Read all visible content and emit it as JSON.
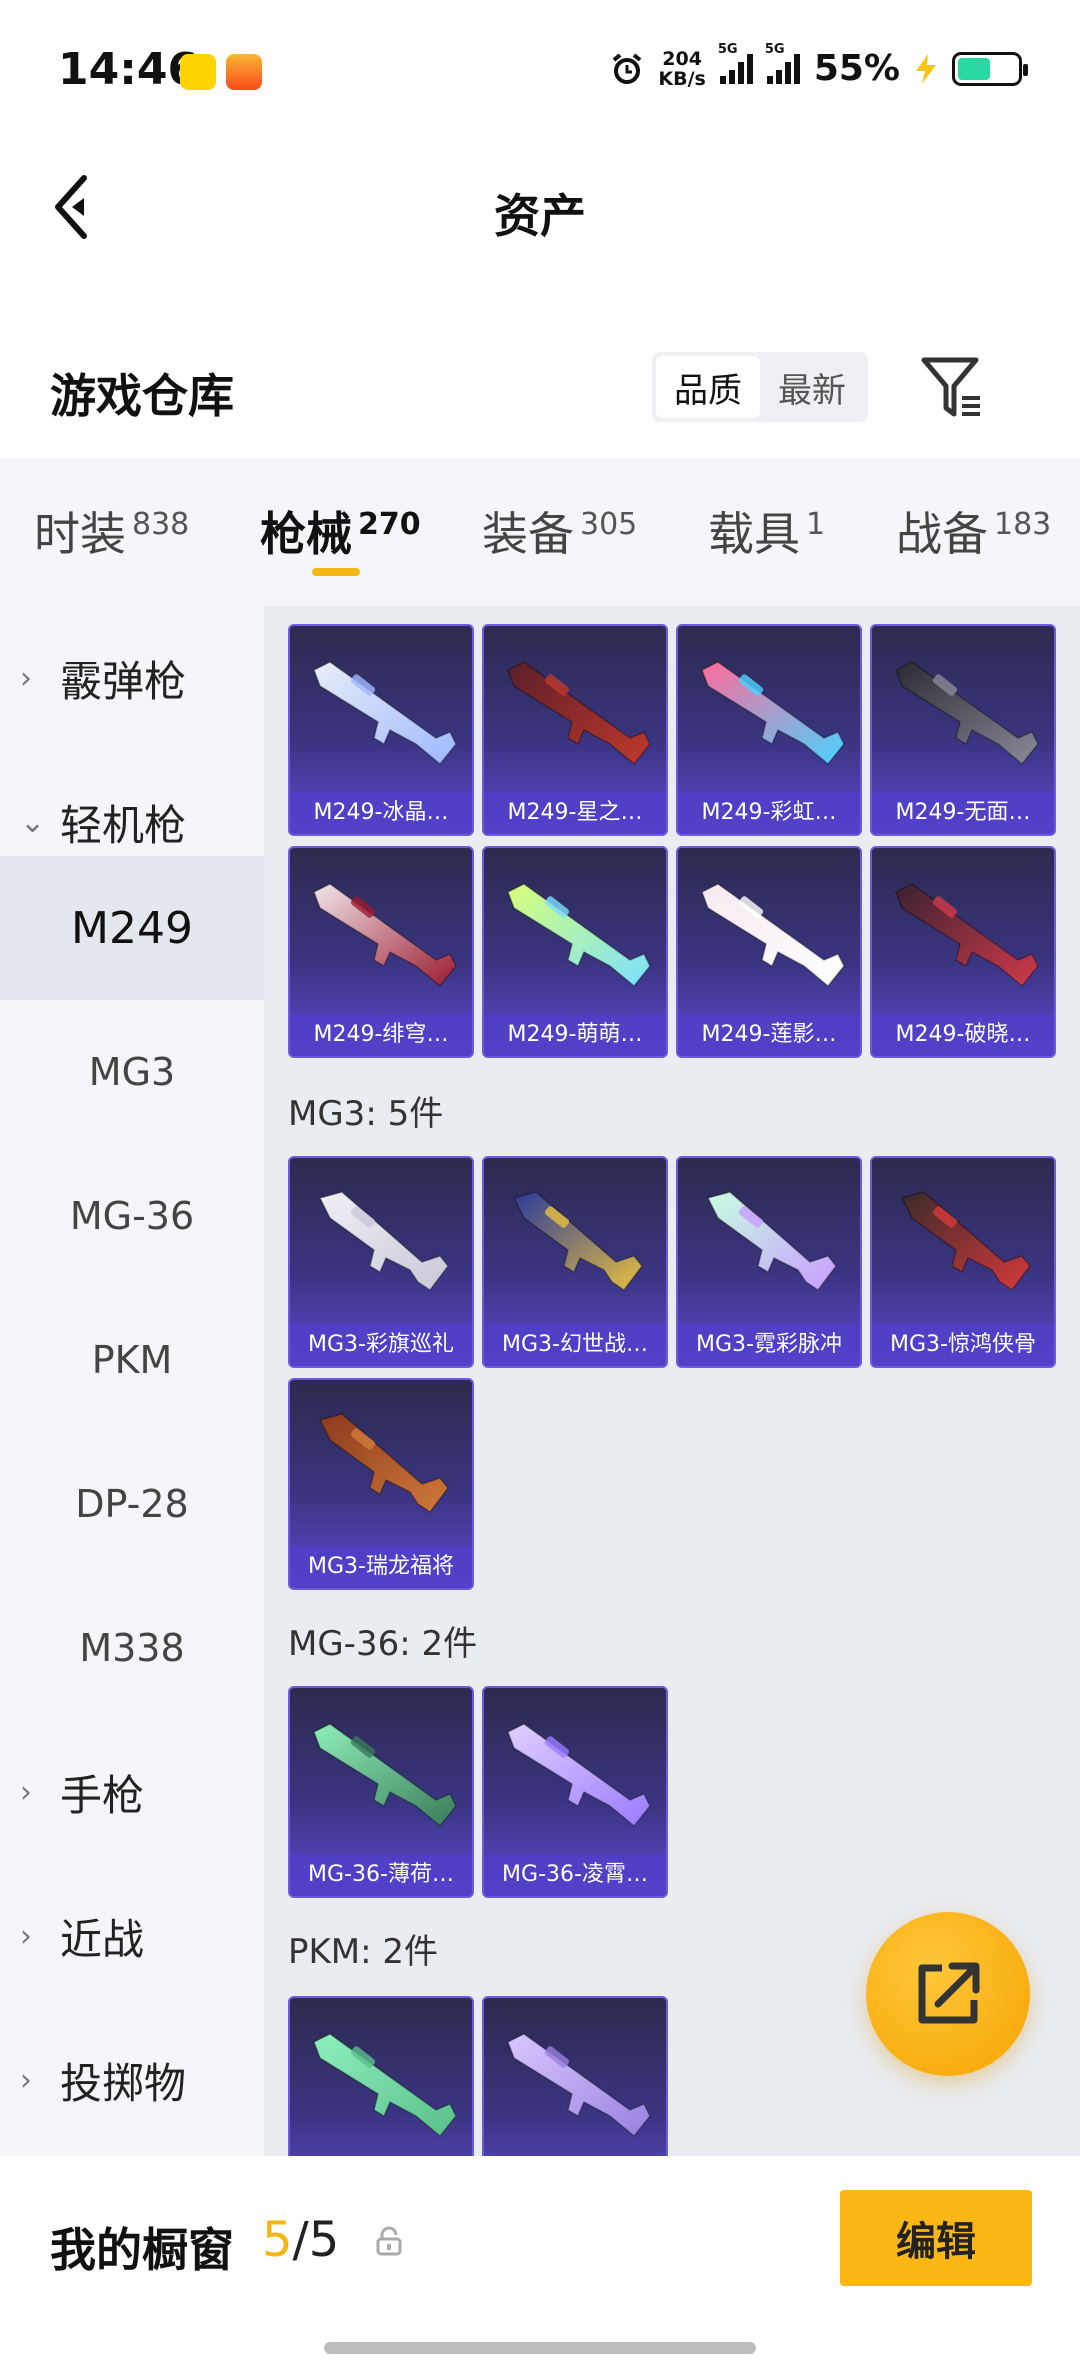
{
  "status_bar": {
    "time": "14:46",
    "net_speed_value": "204",
    "net_speed_unit": "KB/s",
    "signal_tag": "5G",
    "battery_percent": "55%",
    "battery_level": 0.55
  },
  "header": {
    "title": "资产",
    "back_icon": "back-arrow-icon"
  },
  "warehouse": {
    "title": "游戏仓库",
    "sort_options": [
      "品质",
      "最新"
    ],
    "sort_selected": "品质",
    "filter_icon": "filter-icon"
  },
  "tabs": [
    {
      "label": "时装",
      "count": "838"
    },
    {
      "label": "枪械",
      "count": "270",
      "active": true
    },
    {
      "label": "装备",
      "count": "305"
    },
    {
      "label": "载具",
      "count": "1"
    },
    {
      "label": "战备",
      "count": "183"
    }
  ],
  "sidebar": {
    "items": [
      {
        "label": "霰弹枪",
        "type": "group",
        "chevron": "›"
      },
      {
        "label": "轻机枪",
        "type": "group",
        "chevron": "⌄"
      },
      {
        "label": "M249",
        "type": "sub",
        "selected": true
      },
      {
        "label": "MG3",
        "type": "sub"
      },
      {
        "label": "MG-36",
        "type": "sub"
      },
      {
        "label": "PKM",
        "type": "sub"
      },
      {
        "label": "DP-28",
        "type": "sub"
      },
      {
        "label": "M338",
        "type": "sub"
      },
      {
        "label": "手枪",
        "type": "group",
        "chevron": "›"
      },
      {
        "label": "近战",
        "type": "group",
        "chevron": "›"
      },
      {
        "label": "投掷物",
        "type": "group",
        "chevron": "›"
      }
    ]
  },
  "content": {
    "m249_items": [
      "M249-冰晶…",
      "M249-星之…",
      "M249-彩虹…",
      "M249-无面…",
      "M249-绯穹…",
      "M249-萌萌…",
      "M249-莲影…",
      "M249-破晓…"
    ],
    "mg3_title": "MG3: 5件",
    "mg3_items": [
      "MG3-彩旗巡礼",
      "MG3-幻世战…",
      "MG3-霓彩脉冲",
      "MG3-惊鸿侠骨",
      "MG3-瑞龙福将"
    ],
    "mg36_title": "MG-36: 2件",
    "mg36_items": [
      "MG-36-薄荷…",
      "MG-36-凌霄…"
    ],
    "pkm_title": "PKM: 2件",
    "pkm_items": [
      "",
      ""
    ]
  },
  "fab": {
    "icon": "share-external-icon"
  },
  "bottom_bar": {
    "label": "我的橱窗",
    "current": "5",
    "separator": "/",
    "total": "5",
    "lock_icon": "lock-icon",
    "edit_label": "编辑"
  },
  "colors": {
    "accent": "#f5b614",
    "card_gradient_top": "#2c2a4e",
    "card_gradient_bottom": "#5b4ad2",
    "sidebar_bg": "#f4f6fa",
    "content_bg": "#e9ecf1"
  }
}
